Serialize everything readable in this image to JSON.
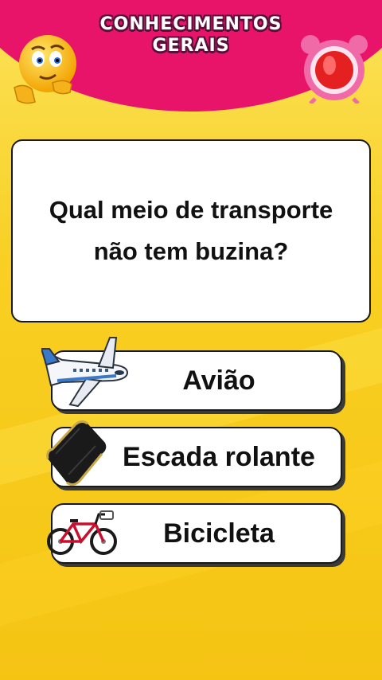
{
  "header": {
    "title_line1": "CONHECIMENTOS",
    "title_line2": "GERAIS",
    "left_icon": "thinking-emoji-icon",
    "right_icon": "alarm-clock-icon"
  },
  "question": {
    "text": "Qual meio de transporte não tem buzina?"
  },
  "answers": [
    {
      "label": "Avião",
      "icon": "airplane-icon"
    },
    {
      "label": "Escada rolante",
      "icon": "escalator-icon"
    },
    {
      "label": "Bicicleta",
      "icon": "bicycle-icon"
    }
  ],
  "colors": {
    "header_pink": "#e8146a",
    "background_yellow": "#f7c817",
    "card_white": "#ffffff",
    "border_dark": "#1a1a1a"
  }
}
